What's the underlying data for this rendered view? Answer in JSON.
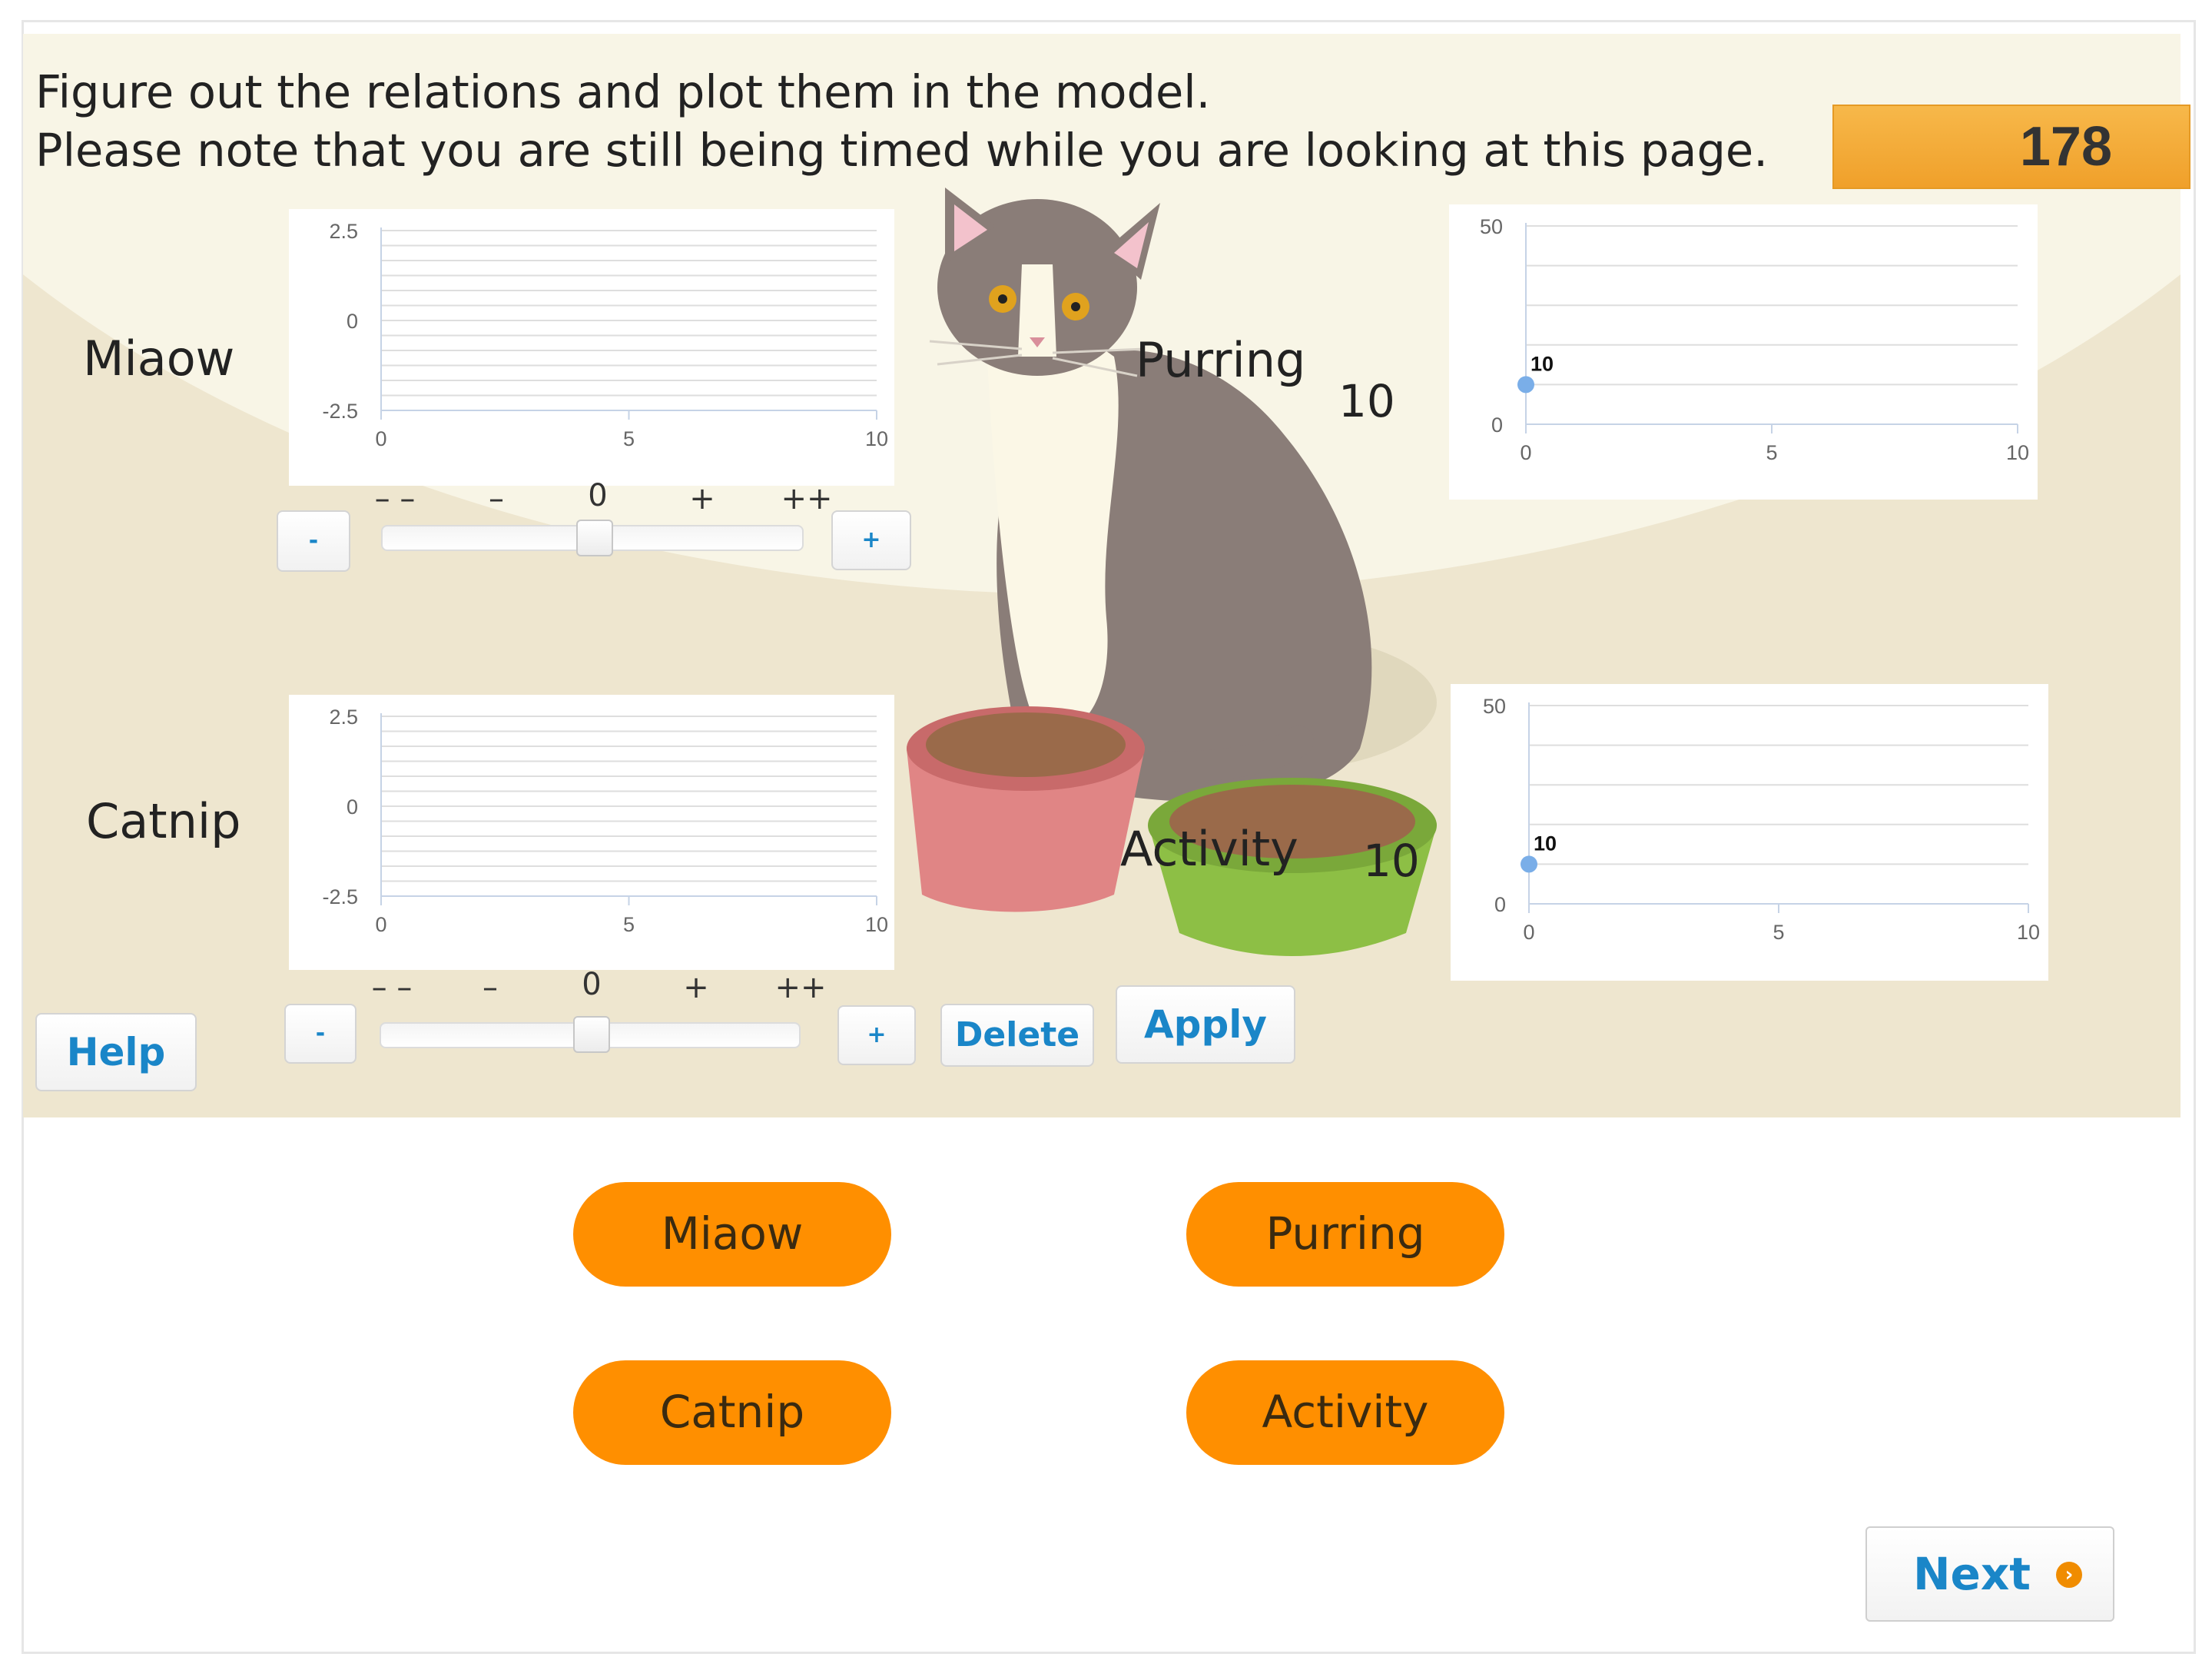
{
  "instructions": {
    "line1": "Figure out the relations and plot them in the model.",
    "line2": "Please note that you are still being timed while you are looking at this page."
  },
  "timer": {
    "value": "178"
  },
  "variables": {
    "miaow": {
      "label": "Miaow"
    },
    "catnip": {
      "label": "Catnip"
    },
    "purring": {
      "label": "Purring",
      "value": "10"
    },
    "activity": {
      "label": "Activity",
      "value": "10"
    }
  },
  "slider": {
    "labels": [
      "– –",
      "–",
      "0",
      "+",
      "++"
    ],
    "minus": "-",
    "plus": "+"
  },
  "buttons": {
    "help": "Help",
    "delete": "Delete",
    "apply": "Apply",
    "next": "Next"
  },
  "answer_options": [
    "Miaow",
    "Purring",
    "Catnip",
    "Activity"
  ],
  "colors": {
    "accent": "#ff8f00",
    "link": "#1a86c8",
    "point": "#7aaee8"
  },
  "chart_data": [
    {
      "type": "line",
      "name": "Miaow",
      "x_ticks": [
        "0",
        "5",
        "10"
      ],
      "y_ticks": [
        "2.5",
        "0",
        "-2.5"
      ],
      "xlim": [
        0,
        10
      ],
      "ylim": [
        -2.5,
        2.5
      ],
      "points": []
    },
    {
      "type": "line",
      "name": "Catnip",
      "x_ticks": [
        "0",
        "5",
        "10"
      ],
      "y_ticks": [
        "2.5",
        "0",
        "-2.5"
      ],
      "xlim": [
        0,
        10
      ],
      "ylim": [
        -2.5,
        2.5
      ],
      "points": []
    },
    {
      "type": "scatter",
      "name": "Purring",
      "x_ticks": [
        "0",
        "5",
        "10"
      ],
      "y_ticks": [
        "50",
        "0"
      ],
      "xlim": [
        0,
        10
      ],
      "ylim": [
        0,
        50
      ],
      "points": [
        {
          "x": 0,
          "y": 10,
          "label": "10"
        }
      ]
    },
    {
      "type": "scatter",
      "name": "Activity",
      "x_ticks": [
        "0",
        "5",
        "10"
      ],
      "y_ticks": [
        "50",
        "0"
      ],
      "xlim": [
        0,
        10
      ],
      "ylim": [
        0,
        50
      ],
      "points": [
        {
          "x": 0,
          "y": 10,
          "label": "10"
        }
      ]
    }
  ]
}
